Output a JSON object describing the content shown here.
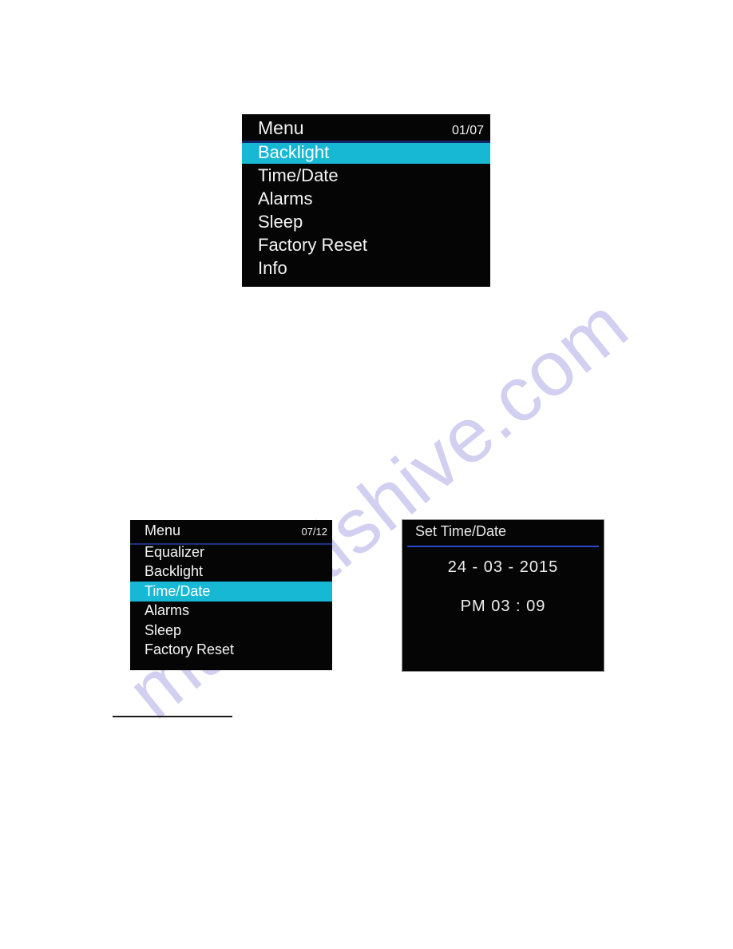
{
  "document": {
    "background_color": "#ffffff",
    "watermark_text": "manualshive.com",
    "watermark_color": "#c9c6ee"
  },
  "colors": {
    "screen_background": "#050505",
    "highlight": "#17b8d4",
    "text": "#f4f4f4",
    "divider_navy": "#16246b",
    "divider_blue": "#2b49c8"
  },
  "screens": {
    "menu_top": {
      "title": "Menu",
      "counter": "01/07",
      "items": [
        {
          "label": "Backlight",
          "selected": true
        },
        {
          "label": "Time/Date",
          "selected": false
        },
        {
          "label": "Alarms",
          "selected": false
        },
        {
          "label": "Sleep",
          "selected": false
        },
        {
          "label": "Factory Reset",
          "selected": false
        },
        {
          "label": "Info",
          "selected": false
        }
      ]
    },
    "menu_bottom": {
      "title": "Menu",
      "counter": "07/12",
      "items": [
        {
          "label": "Equalizer",
          "selected": false
        },
        {
          "label": "Backlight",
          "selected": false
        },
        {
          "label": "Time/Date",
          "selected": true
        },
        {
          "label": "Alarms",
          "selected": false
        },
        {
          "label": "Sleep",
          "selected": false
        },
        {
          "label": "Factory Reset",
          "selected": false
        }
      ]
    },
    "set_time_date": {
      "title": "Set Time/Date",
      "date_value": "24 - 03 - 2015",
      "time_value": "PM  03 : 09"
    }
  }
}
